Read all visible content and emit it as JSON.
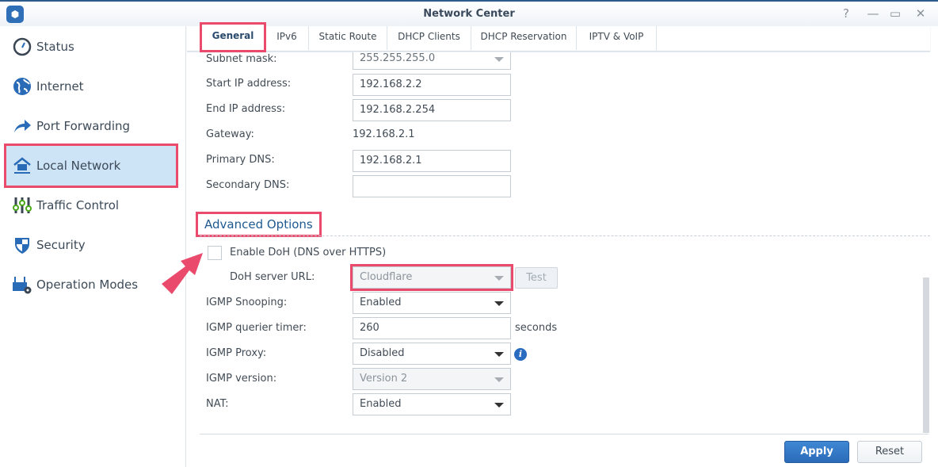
{
  "window": {
    "title": "Network Center",
    "buttons": [
      "help",
      "minimize",
      "maximize",
      "close"
    ]
  },
  "sidebar": {
    "items": [
      {
        "label": "Status",
        "icon": "gauge-icon"
      },
      {
        "label": "Internet",
        "icon": "globe-icon"
      },
      {
        "label": "Port Forwarding",
        "icon": "arrow-forward-icon"
      },
      {
        "label": "Local Network",
        "icon": "house-network-icon",
        "active": true
      },
      {
        "label": "Traffic Control",
        "icon": "sliders-icon"
      },
      {
        "label": "Security",
        "icon": "shield-icon"
      },
      {
        "label": "Operation Modes",
        "icon": "router-gear-icon"
      }
    ]
  },
  "tabs": [
    "General",
    "IPv6",
    "Static Route",
    "DHCP Clients",
    "DHCP Reservation",
    "IPTV & VoIP"
  ],
  "active_tab": "General",
  "form": {
    "subnet_mask": {
      "label": "Subnet mask:",
      "value": "255.255.255.0"
    },
    "start_ip": {
      "label": "Start IP address:",
      "value": "192.168.2.2"
    },
    "end_ip": {
      "label": "End IP address:",
      "value": "192.168.2.254"
    },
    "gateway": {
      "label": "Gateway:",
      "value": "192.168.2.1"
    },
    "primary_dns": {
      "label": "Primary DNS:",
      "value": "192.168.2.1"
    },
    "secondary_dns": {
      "label": "Secondary DNS:",
      "value": ""
    }
  },
  "advanced": {
    "title": "Advanced Options",
    "doh_enable": {
      "label": "Enable DoH (DNS over HTTPS)",
      "checked": false
    },
    "doh_url": {
      "label": "DoH server URL:",
      "value": "Cloudflare",
      "test": "Test"
    },
    "igmp_snooping": {
      "label": "IGMP Snooping:",
      "value": "Enabled"
    },
    "igmp_timer": {
      "label": "IGMP querier timer:",
      "value": "260",
      "unit": "seconds"
    },
    "igmp_proxy": {
      "label": "IGMP Proxy:",
      "value": "Disabled"
    },
    "igmp_version": {
      "label": "IGMP version:",
      "value": "Version 2"
    },
    "nat": {
      "label": "NAT:",
      "value": "Enabled"
    }
  },
  "footer": {
    "apply": "Apply",
    "reset": "Reset"
  },
  "colors": {
    "accent": "#2a6bb8",
    "highlight": "#ea4a6c",
    "active_nav": "#cde3f6"
  }
}
